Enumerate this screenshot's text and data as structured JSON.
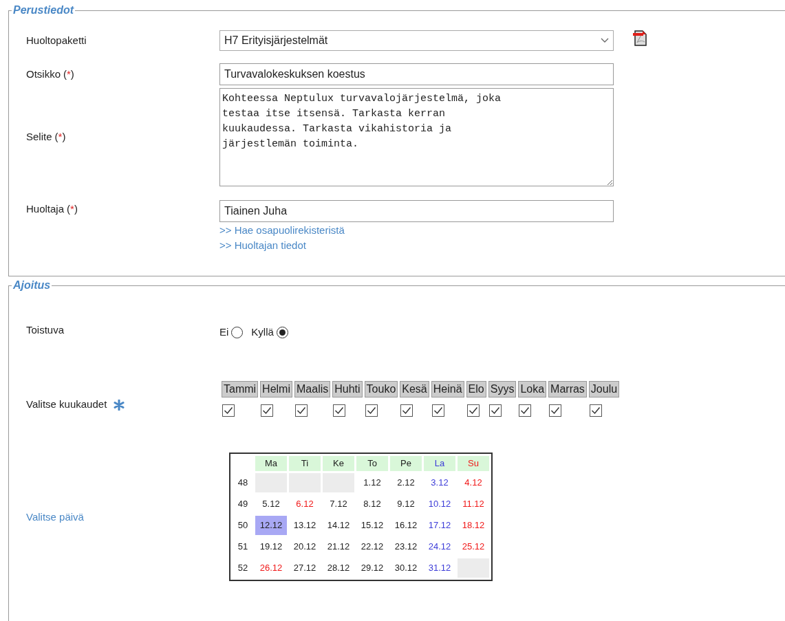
{
  "perustiedot": {
    "legend": "Perustiedot",
    "huoltopaketti": {
      "label": "Huoltopaketti",
      "value": "H7 Erityisjärjestelmät"
    },
    "otsikko": {
      "label": "Otsikko",
      "required": "(*)",
      "value": "Turvavalokeskuksen koestus"
    },
    "selite": {
      "label": "Selite",
      "required": "(*)",
      "value": "Kohteessa Neptulux turvavalojärjestelmä, joka\ntestaa itse itsensä. Tarkasta kerran\nkuukaudessa. Tarkasta vikahistoria ja\njärjestlemän toiminta."
    },
    "huoltaja": {
      "label": "Huoltaja",
      "required": "(*)",
      "value": "Tiainen Juha"
    },
    "links": [
      ">> Hae osapuolirekisteristä",
      ">> Huoltajan tiedot"
    ]
  },
  "ajoitus": {
    "legend": "Ajoitus",
    "toistuva": {
      "label": "Toistuva",
      "options": [
        {
          "label": "Ei",
          "selected": false
        },
        {
          "label": "Kyllä",
          "selected": true
        }
      ]
    },
    "kuukaudet": {
      "label": "Valitse kuukaudet",
      "months": [
        {
          "label": "Tammi",
          "checked": true
        },
        {
          "label": "Helmi",
          "checked": true
        },
        {
          "label": "Maalis",
          "checked": true
        },
        {
          "label": "Huhti",
          "checked": true
        },
        {
          "label": "Touko",
          "checked": true
        },
        {
          "label": "Kesä",
          "checked": true
        },
        {
          "label": "Heinä",
          "checked": true
        },
        {
          "label": "Elo",
          "checked": true
        },
        {
          "label": "Syys",
          "checked": true
        },
        {
          "label": "Loka",
          "checked": true
        },
        {
          "label": "Marras",
          "checked": true
        },
        {
          "label": "Joulu",
          "checked": true
        }
      ]
    },
    "paiva": {
      "label": "Valitse päivä",
      "headers": [
        {
          "label": "Ma",
          "kind": "weekday"
        },
        {
          "label": "Ti",
          "kind": "weekday"
        },
        {
          "label": "Ke",
          "kind": "weekday"
        },
        {
          "label": "To",
          "kind": "weekday"
        },
        {
          "label": "Pe",
          "kind": "weekday"
        },
        {
          "label": "La",
          "kind": "saturday"
        },
        {
          "label": "Su",
          "kind": "holiday"
        }
      ],
      "weeks": [
        {
          "week": "48",
          "days": [
            {
              "kind": "empty"
            },
            {
              "kind": "empty"
            },
            {
              "kind": "empty"
            },
            {
              "text": "1.12",
              "kind": "weekday",
              "selected": false
            },
            {
              "text": "2.12",
              "kind": "weekday",
              "selected": false
            },
            {
              "text": "3.12",
              "kind": "saturday",
              "selected": false
            },
            {
              "text": "4.12",
              "kind": "holiday",
              "selected": false
            }
          ]
        },
        {
          "week": "49",
          "days": [
            {
              "text": "5.12",
              "kind": "weekday",
              "selected": false
            },
            {
              "text": "6.12",
              "kind": "holiday",
              "selected": false
            },
            {
              "text": "7.12",
              "kind": "weekday",
              "selected": false
            },
            {
              "text": "8.12",
              "kind": "weekday",
              "selected": false
            },
            {
              "text": "9.12",
              "kind": "weekday",
              "selected": false
            },
            {
              "text": "10.12",
              "kind": "saturday",
              "selected": false
            },
            {
              "text": "11.12",
              "kind": "holiday",
              "selected": false
            }
          ]
        },
        {
          "week": "50",
          "days": [
            {
              "text": "12.12",
              "kind": "weekday",
              "selected": true
            },
            {
              "text": "13.12",
              "kind": "weekday",
              "selected": false
            },
            {
              "text": "14.12",
              "kind": "weekday",
              "selected": false
            },
            {
              "text": "15.12",
              "kind": "weekday",
              "selected": false
            },
            {
              "text": "16.12",
              "kind": "weekday",
              "selected": false
            },
            {
              "text": "17.12",
              "kind": "saturday",
              "selected": false
            },
            {
              "text": "18.12",
              "kind": "holiday",
              "selected": false
            }
          ]
        },
        {
          "week": "51",
          "days": [
            {
              "text": "19.12",
              "kind": "weekday",
              "selected": false
            },
            {
              "text": "20.12",
              "kind": "weekday",
              "selected": false
            },
            {
              "text": "21.12",
              "kind": "weekday",
              "selected": false
            },
            {
              "text": "22.12",
              "kind": "weekday",
              "selected": false
            },
            {
              "text": "23.12",
              "kind": "weekday",
              "selected": false
            },
            {
              "text": "24.12",
              "kind": "saturday",
              "selected": false
            },
            {
              "text": "25.12",
              "kind": "holiday",
              "selected": false
            }
          ]
        },
        {
          "week": "52",
          "days": [
            {
              "text": "26.12",
              "kind": "holiday",
              "selected": false
            },
            {
              "text": "27.12",
              "kind": "weekday",
              "selected": false
            },
            {
              "text": "28.12",
              "kind": "weekday",
              "selected": false
            },
            {
              "text": "29.12",
              "kind": "weekday",
              "selected": false
            },
            {
              "text": "30.12",
              "kind": "weekday",
              "selected": false
            },
            {
              "text": "31.12",
              "kind": "saturday",
              "selected": false
            },
            {
              "kind": "empty"
            }
          ]
        }
      ]
    }
  }
}
